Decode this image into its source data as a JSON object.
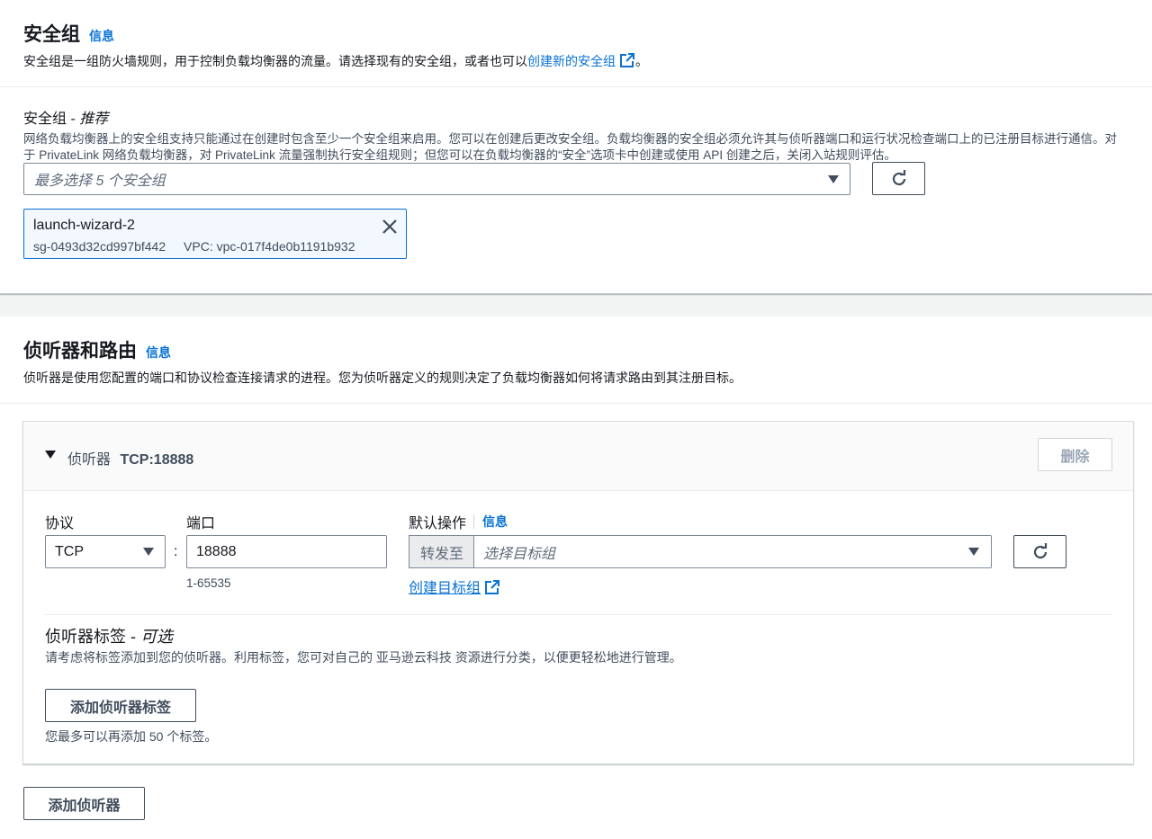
{
  "security_group": {
    "title": "安全组",
    "info": "信息",
    "desc_before": "安全组是一组防火墙规则，用于控制负载均衡器的流量。请选择现有的安全组，或者也可以",
    "create_link": "创建新的安全组",
    "desc_after": "。",
    "field_label": "安全组 - ",
    "field_label_hint": "推荐",
    "field_desc": "网络负载均衡器上的安全组支持只能通过在创建时包含至少一个安全组来启用。您可以在创建后更改安全组。负载均衡器的安全组必须允许其与侦听器端口和运行状况检查端口上的已注册目标进行通信。对于 PrivateLink 网络负载均衡器，对 PrivateLink 流量强制执行安全组规则；但您可以在负载均衡器的“安全”选项卡中创建或使用 API 创建之后，关闭入站规则评估。",
    "select_placeholder": "最多选择 5 个安全组",
    "selected": {
      "name": "launch-wizard-2",
      "id": "sg-0493d32cd997bf442",
      "vpc": "VPC: vpc-017f4de0b1191b932"
    }
  },
  "listeners": {
    "title": "侦听器和路由",
    "info": "信息",
    "desc": "侦听器是使用您配置的端口和协议检查连接请求的进程。您为侦听器定义的规则决定了负载均衡器如何将请求路由到其注册目标。",
    "listener": {
      "header_prefix": "侦听器",
      "header_value": "TCP:18888",
      "remove_label": "删除",
      "protocol_label": "协议",
      "protocol_value": "TCP",
      "colon": ":",
      "port_label": "端口",
      "port_value": "18888",
      "port_hint": "1-65535",
      "default_action_label": "默认操作",
      "default_action_info": "信息",
      "forward_to": "转发至",
      "target_placeholder": "选择目标组",
      "create_target_link": "创建目标组",
      "tags_label": "侦听器标签 - ",
      "tags_label_hint": "可选",
      "tags_desc": "请考虑将标签添加到您的侦听器。利用标签，您可对自己的 亚马逊云科技 资源进行分类，以便更轻松地进行管理。",
      "add_tag_button": "添加侦听器标签",
      "tag_limit": "您最多可以再添加 50 个标签。"
    },
    "add_listener_button": "添加侦听器"
  },
  "colors": {
    "link": "#0972d3",
    "border": "#7d8998",
    "token_bg": "#f2f8fd"
  }
}
